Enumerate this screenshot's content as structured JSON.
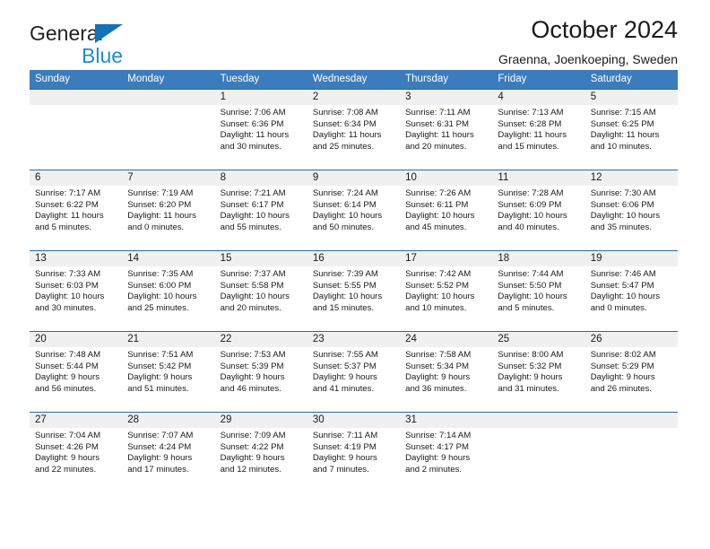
{
  "brand": {
    "line1": "General",
    "line2": "Blue",
    "triangle_color": "#1271b8",
    "line2_color": "#1f8ae0"
  },
  "header": {
    "title": "October 2024",
    "location": "Graenna, Joenkoeping, Sweden"
  },
  "theme": {
    "header_blue": "#3a7cbd",
    "row_rule": "#2a6aa8",
    "daynum_strip": "#f0f0f0"
  },
  "weekdays": [
    "Sunday",
    "Monday",
    "Tuesday",
    "Wednesday",
    "Thursday",
    "Friday",
    "Saturday"
  ],
  "labels": {
    "sunrise": "Sunrise:",
    "sunset": "Sunset:",
    "daylight": "Daylight:"
  },
  "weeks": [
    [
      {
        "day": ""
      },
      {
        "day": ""
      },
      {
        "day": "1",
        "sunrise": "Sunrise: 7:06 AM",
        "sunset": "Sunset: 6:36 PM",
        "daylight1": "Daylight: 11 hours",
        "daylight2": "and 30 minutes."
      },
      {
        "day": "2",
        "sunrise": "Sunrise: 7:08 AM",
        "sunset": "Sunset: 6:34 PM",
        "daylight1": "Daylight: 11 hours",
        "daylight2": "and 25 minutes."
      },
      {
        "day": "3",
        "sunrise": "Sunrise: 7:11 AM",
        "sunset": "Sunset: 6:31 PM",
        "daylight1": "Daylight: 11 hours",
        "daylight2": "and 20 minutes."
      },
      {
        "day": "4",
        "sunrise": "Sunrise: 7:13 AM",
        "sunset": "Sunset: 6:28 PM",
        "daylight1": "Daylight: 11 hours",
        "daylight2": "and 15 minutes."
      },
      {
        "day": "5",
        "sunrise": "Sunrise: 7:15 AM",
        "sunset": "Sunset: 6:25 PM",
        "daylight1": "Daylight: 11 hours",
        "daylight2": "and 10 minutes."
      }
    ],
    [
      {
        "day": "6",
        "sunrise": "Sunrise: 7:17 AM",
        "sunset": "Sunset: 6:22 PM",
        "daylight1": "Daylight: 11 hours",
        "daylight2": "and 5 minutes."
      },
      {
        "day": "7",
        "sunrise": "Sunrise: 7:19 AM",
        "sunset": "Sunset: 6:20 PM",
        "daylight1": "Daylight: 11 hours",
        "daylight2": "and 0 minutes."
      },
      {
        "day": "8",
        "sunrise": "Sunrise: 7:21 AM",
        "sunset": "Sunset: 6:17 PM",
        "daylight1": "Daylight: 10 hours",
        "daylight2": "and 55 minutes."
      },
      {
        "day": "9",
        "sunrise": "Sunrise: 7:24 AM",
        "sunset": "Sunset: 6:14 PM",
        "daylight1": "Daylight: 10 hours",
        "daylight2": "and 50 minutes."
      },
      {
        "day": "10",
        "sunrise": "Sunrise: 7:26 AM",
        "sunset": "Sunset: 6:11 PM",
        "daylight1": "Daylight: 10 hours",
        "daylight2": "and 45 minutes."
      },
      {
        "day": "11",
        "sunrise": "Sunrise: 7:28 AM",
        "sunset": "Sunset: 6:09 PM",
        "daylight1": "Daylight: 10 hours",
        "daylight2": "and 40 minutes."
      },
      {
        "day": "12",
        "sunrise": "Sunrise: 7:30 AM",
        "sunset": "Sunset: 6:06 PM",
        "daylight1": "Daylight: 10 hours",
        "daylight2": "and 35 minutes."
      }
    ],
    [
      {
        "day": "13",
        "sunrise": "Sunrise: 7:33 AM",
        "sunset": "Sunset: 6:03 PM",
        "daylight1": "Daylight: 10 hours",
        "daylight2": "and 30 minutes."
      },
      {
        "day": "14",
        "sunrise": "Sunrise: 7:35 AM",
        "sunset": "Sunset: 6:00 PM",
        "daylight1": "Daylight: 10 hours",
        "daylight2": "and 25 minutes."
      },
      {
        "day": "15",
        "sunrise": "Sunrise: 7:37 AM",
        "sunset": "Sunset: 5:58 PM",
        "daylight1": "Daylight: 10 hours",
        "daylight2": "and 20 minutes."
      },
      {
        "day": "16",
        "sunrise": "Sunrise: 7:39 AM",
        "sunset": "Sunset: 5:55 PM",
        "daylight1": "Daylight: 10 hours",
        "daylight2": "and 15 minutes."
      },
      {
        "day": "17",
        "sunrise": "Sunrise: 7:42 AM",
        "sunset": "Sunset: 5:52 PM",
        "daylight1": "Daylight: 10 hours",
        "daylight2": "and 10 minutes."
      },
      {
        "day": "18",
        "sunrise": "Sunrise: 7:44 AM",
        "sunset": "Sunset: 5:50 PM",
        "daylight1": "Daylight: 10 hours",
        "daylight2": "and 5 minutes."
      },
      {
        "day": "19",
        "sunrise": "Sunrise: 7:46 AM",
        "sunset": "Sunset: 5:47 PM",
        "daylight1": "Daylight: 10 hours",
        "daylight2": "and 0 minutes."
      }
    ],
    [
      {
        "day": "20",
        "sunrise": "Sunrise: 7:48 AM",
        "sunset": "Sunset: 5:44 PM",
        "daylight1": "Daylight: 9 hours",
        "daylight2": "and 56 minutes."
      },
      {
        "day": "21",
        "sunrise": "Sunrise: 7:51 AM",
        "sunset": "Sunset: 5:42 PM",
        "daylight1": "Daylight: 9 hours",
        "daylight2": "and 51 minutes."
      },
      {
        "day": "22",
        "sunrise": "Sunrise: 7:53 AM",
        "sunset": "Sunset: 5:39 PM",
        "daylight1": "Daylight: 9 hours",
        "daylight2": "and 46 minutes."
      },
      {
        "day": "23",
        "sunrise": "Sunrise: 7:55 AM",
        "sunset": "Sunset: 5:37 PM",
        "daylight1": "Daylight: 9 hours",
        "daylight2": "and 41 minutes."
      },
      {
        "day": "24",
        "sunrise": "Sunrise: 7:58 AM",
        "sunset": "Sunset: 5:34 PM",
        "daylight1": "Daylight: 9 hours",
        "daylight2": "and 36 minutes."
      },
      {
        "day": "25",
        "sunrise": "Sunrise: 8:00 AM",
        "sunset": "Sunset: 5:32 PM",
        "daylight1": "Daylight: 9 hours",
        "daylight2": "and 31 minutes."
      },
      {
        "day": "26",
        "sunrise": "Sunrise: 8:02 AM",
        "sunset": "Sunset: 5:29 PM",
        "daylight1": "Daylight: 9 hours",
        "daylight2": "and 26 minutes."
      }
    ],
    [
      {
        "day": "27",
        "sunrise": "Sunrise: 7:04 AM",
        "sunset": "Sunset: 4:26 PM",
        "daylight1": "Daylight: 9 hours",
        "daylight2": "and 22 minutes."
      },
      {
        "day": "28",
        "sunrise": "Sunrise: 7:07 AM",
        "sunset": "Sunset: 4:24 PM",
        "daylight1": "Daylight: 9 hours",
        "daylight2": "and 17 minutes."
      },
      {
        "day": "29",
        "sunrise": "Sunrise: 7:09 AM",
        "sunset": "Sunset: 4:22 PM",
        "daylight1": "Daylight: 9 hours",
        "daylight2": "and 12 minutes."
      },
      {
        "day": "30",
        "sunrise": "Sunrise: 7:11 AM",
        "sunset": "Sunset: 4:19 PM",
        "daylight1": "Daylight: 9 hours",
        "daylight2": "and 7 minutes."
      },
      {
        "day": "31",
        "sunrise": "Sunrise: 7:14 AM",
        "sunset": "Sunset: 4:17 PM",
        "daylight1": "Daylight: 9 hours",
        "daylight2": "and 2 minutes."
      },
      {
        "day": ""
      },
      {
        "day": ""
      }
    ]
  ]
}
